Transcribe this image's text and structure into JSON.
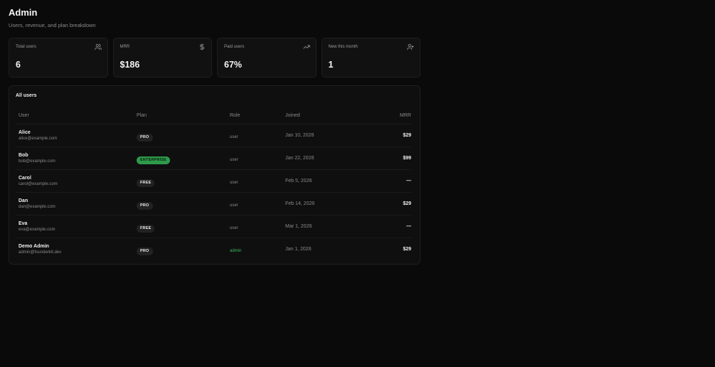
{
  "header": {
    "title": "Admin",
    "subtitle": "Users, revenue, and plan breakdown"
  },
  "stats": [
    {
      "label": "Total users",
      "value": "6",
      "icon": "users-icon"
    },
    {
      "label": "MRR",
      "value": "$186",
      "icon": "dollar-icon"
    },
    {
      "label": "Paid users",
      "value": "67%",
      "icon": "trending-up-icon"
    },
    {
      "label": "New this month",
      "value": "1",
      "icon": "user-plus-icon"
    }
  ],
  "users_table": {
    "title": "All users",
    "columns": {
      "user": "User",
      "plan": "Plan",
      "role": "Role",
      "joined": "Joined",
      "mrr": "MRR"
    },
    "rows": [
      {
        "name": "Alice",
        "email": "alice@example.com",
        "plan": "PRO",
        "role": "user",
        "joined": "Jan 10, 2026",
        "mrr": "$29"
      },
      {
        "name": "Bob",
        "email": "bob@example.com",
        "plan": "ENTERPRISE",
        "role": "user",
        "joined": "Jan 22, 2026",
        "mrr": "$99"
      },
      {
        "name": "Carol",
        "email": "carol@example.com",
        "plan": "FREE",
        "role": "user",
        "joined": "Feb 5, 2026",
        "mrr": "—"
      },
      {
        "name": "Dan",
        "email": "dan@example.com",
        "plan": "PRO",
        "role": "user",
        "joined": "Feb 14, 2026",
        "mrr": "$29"
      },
      {
        "name": "Eva",
        "email": "eva@example.com",
        "plan": "FREE",
        "role": "user",
        "joined": "Mar 1, 2026",
        "mrr": "—"
      },
      {
        "name": "Demo Admin",
        "email": "admin@founderkit.dev",
        "plan": "PRO",
        "role": "admin",
        "joined": "Jan 1, 2026",
        "mrr": "$29"
      }
    ]
  },
  "colors": {
    "background": "#0a0a0a",
    "card": "#111111",
    "enterprise_badge": "#2e9a4a",
    "admin_role": "#3fb95f"
  }
}
